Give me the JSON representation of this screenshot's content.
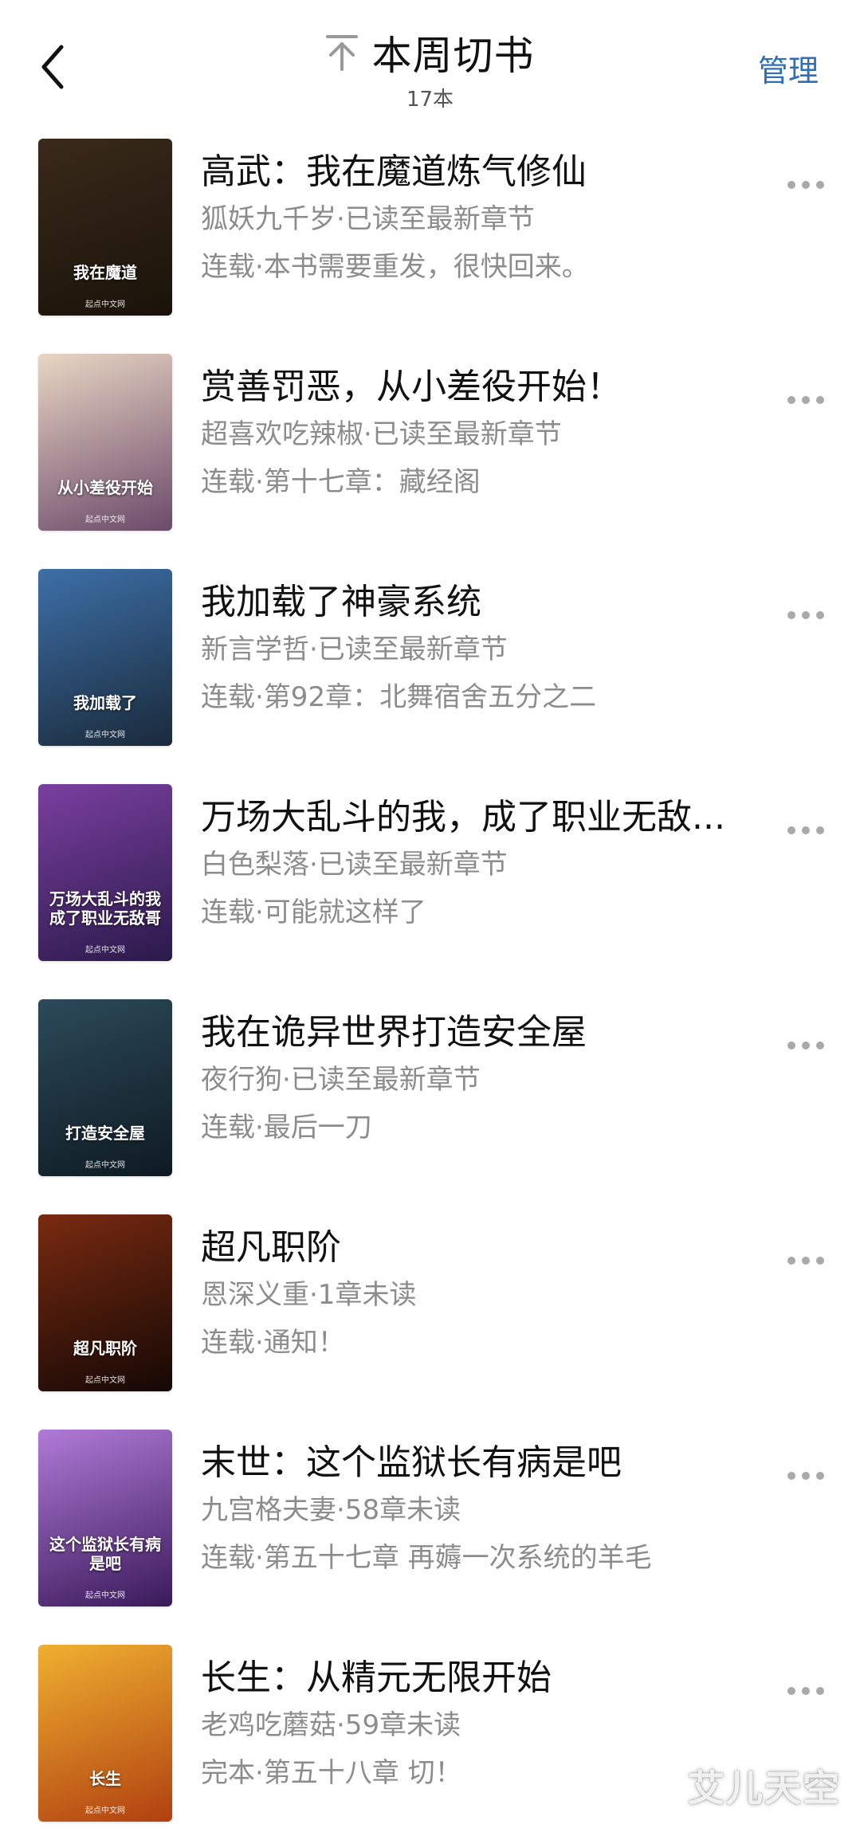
{
  "header": {
    "title": "本周切书",
    "count": "17本",
    "manage_label": "管理",
    "back_icon": "chevron-left-icon",
    "title_icon": "arrow-up-to-top-icon"
  },
  "books": [
    {
      "title": "高武：我在魔道炼气修仙",
      "meta": "狐妖九千岁·已读至最新章节",
      "status": "连载·本书需要重发，很快回来。",
      "cover_colors": [
        "#3a2a1a",
        "#1a120a"
      ]
    },
    {
      "title": "赏善罚恶，从小差役开始！",
      "meta": "超喜欢吃辣椒·已读至最新章节",
      "status": "连载·第十七章：藏经阁",
      "cover_colors": [
        "#e9d6c4",
        "#6b4a6a"
      ]
    },
    {
      "title": "我加载了神豪系统",
      "meta": "新言学哲·已读至最新章节",
      "status": "连载·第92章：北舞宿舍五分之二",
      "cover_colors": [
        "#3d6fa8",
        "#1a2a3a"
      ]
    },
    {
      "title": "万场大乱斗的我，成了职业无敌...",
      "meta": "白色梨落·已读至最新章节",
      "status": "连载·可能就这样了",
      "cover_colors": [
        "#7a3fa0",
        "#2a1a4a"
      ]
    },
    {
      "title": "我在诡异世界打造安全屋",
      "meta": "夜行狗·已读至最新章节",
      "status": "连载·最后一刀",
      "cover_colors": [
        "#2c4a5a",
        "#0e1a22"
      ]
    },
    {
      "title": "超凡职阶",
      "meta": "恩深义重·1章未读",
      "status": "连载·通知！",
      "cover_colors": [
        "#7a2a10",
        "#140805"
      ]
    },
    {
      "title": "末世：这个监狱长有病是吧",
      "meta": "九宫格夫妻·58章未读",
      "status": "连载·第五十七章 再薅一次系统的羊毛",
      "cover_colors": [
        "#b07ad8",
        "#3a1a5a"
      ]
    },
    {
      "title": "长生：从精元无限开始",
      "meta": "老鸡吃蘑菇·59章未读",
      "status": "完本·第五十八章 切！",
      "cover_colors": [
        "#f0b030",
        "#b04010"
      ]
    }
  ],
  "cover_texts": [
    "我在魔道",
    "从小差役开始",
    "我加载了",
    "万场大乱斗的我成了职业无敌哥",
    "打造安全屋",
    "超凡职阶",
    "这个监狱长有病是吧",
    "长生"
  ],
  "cover_publisher": "起点中文网",
  "watermark": "艾儿天空"
}
